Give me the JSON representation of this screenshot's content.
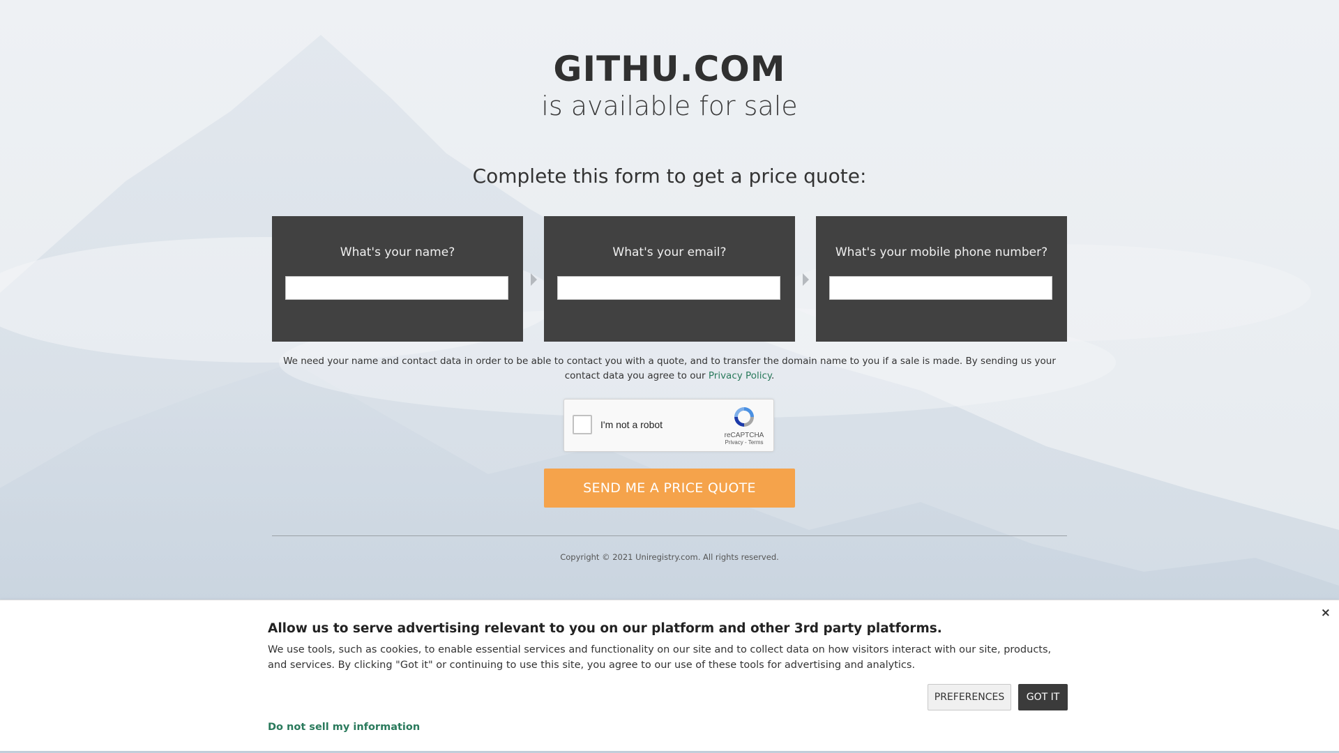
{
  "header": {
    "domain": "GITHU.COM",
    "subtitle": "is available for sale"
  },
  "form": {
    "heading": "Complete this form to get a price quote:",
    "fields": [
      {
        "label": "What's your name?",
        "value": ""
      },
      {
        "label": "What's your email?",
        "value": ""
      },
      {
        "label": "What's your mobile phone number?",
        "value": ""
      }
    ],
    "disclaimer_text": "We need your name and contact data in order to be able to contact you with a quote, and to transfer the domain name to you if a sale is made. By sending us your contact data you agree to our ",
    "privacy_link": "Privacy Policy",
    "disclaimer_end": ".",
    "recaptcha": {
      "label": "I'm not a robot",
      "brand": "reCAPTCHA",
      "links": "Privacy - Terms"
    },
    "submit_label": "SEND ME A PRICE QUOTE"
  },
  "footer": {
    "copyright": "Copyright © 2021 Uniregistry.com. All rights reserved."
  },
  "cookie_banner": {
    "title": "Allow us to serve advertising relevant to you on our platform and other 3rd party platforms.",
    "body": "We use tools, such as cookies, to enable essential services and functionality on our site and to collect data on how visitors interact with our site, products, and services. By clicking \"Got it\" or continuing to use this site, you agree to our use of these tools for advertising and analytics.",
    "preferences_label": "PREFERENCES",
    "got_it_label": "GOT IT",
    "do_not_sell_label": "Do not sell my information",
    "close_glyph": "×"
  },
  "colors": {
    "panel": "#414141",
    "submit": "#f5a34b",
    "link": "#2a7a5c",
    "got_it": "#3b3b3b"
  }
}
